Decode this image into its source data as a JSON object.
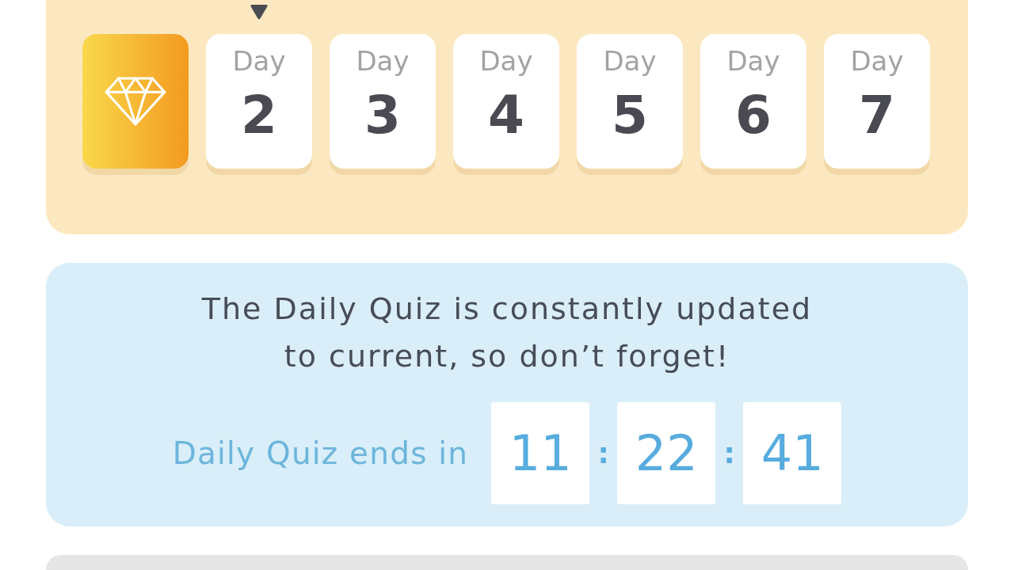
{
  "streak": {
    "days": [
      {
        "claimed": true,
        "current": false
      },
      {
        "label": "Day",
        "number": "2",
        "claimed": false,
        "current": true
      },
      {
        "label": "Day",
        "number": "3",
        "claimed": false,
        "current": false
      },
      {
        "label": "Day",
        "number": "4",
        "claimed": false,
        "current": false
      },
      {
        "label": "Day",
        "number": "5",
        "claimed": false,
        "current": false
      },
      {
        "label": "Day",
        "number": "6",
        "claimed": false,
        "current": false
      },
      {
        "label": "Day",
        "number": "7",
        "claimed": false,
        "current": false
      }
    ]
  },
  "quiz": {
    "message": "The Daily Quiz is constantly updated\nto current, so don’t forget!",
    "countdown": {
      "label": "Daily Quiz ends in",
      "parts": [
        {
          "kind": "digits",
          "text": "11"
        },
        {
          "kind": "separator",
          "text": ":"
        },
        {
          "kind": "digits",
          "text": "22"
        },
        {
          "kind": "separator",
          "text": ":"
        },
        {
          "kind": "digits",
          "text": "41"
        }
      ]
    }
  }
}
